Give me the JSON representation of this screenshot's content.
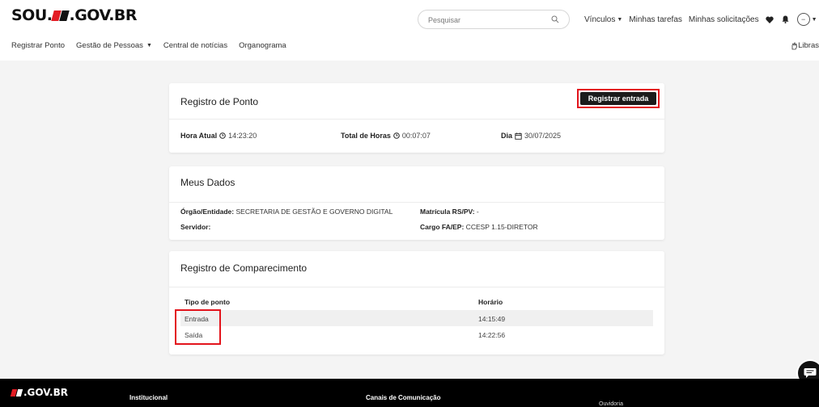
{
  "header": {
    "logo_left": "SOU.",
    "logo_right": ".GOV.BR",
    "search_placeholder": "Pesquisar",
    "nav": {
      "vinculos": "Vínculos",
      "tarefas": "Minhas tarefas",
      "solicitacoes": "Minhas solicitações"
    },
    "libras": "Libras"
  },
  "subnav": {
    "items": [
      "Registrar Ponto",
      "Gestão de Pessoas",
      "Central de notícias",
      "Organograma"
    ]
  },
  "registro_ponto": {
    "title": "Registro de Ponto",
    "button_label": "Registrar entrada",
    "hora_atual_label": "Hora Atual",
    "hora_atual_value": "14:23:20",
    "total_horas_label": "Total de Horas",
    "total_horas_value": "00:07:07",
    "dia_label": "Dia",
    "dia_value": "30/07/2025"
  },
  "meus_dados": {
    "title": "Meus Dados",
    "orgao_label": "Órgão/Entidade:",
    "orgao_value": " SECRETARIA DE GESTÃO E GOVERNO DIGITAL",
    "servidor_label": "Servidor:",
    "servidor_value": "",
    "matricula_label": "Matrícula RS/PV:",
    "matricula_value": " -",
    "cargo_label": "Cargo FA/EP:",
    "cargo_value": " CCESP 1.15-DIRETOR"
  },
  "comparecimento": {
    "title": "Registro de Comparecimento",
    "col_tipo": "Tipo de ponto",
    "col_horario": "Horário",
    "rows": [
      {
        "tipo": "Entrada",
        "horario": "14:15:49"
      },
      {
        "tipo": "Saída",
        "horario": "14:22:56"
      }
    ]
  },
  "footer": {
    "logo": ".GOV.BR",
    "institucional": "Institucional",
    "canais": "Canais de Comunicação",
    "ouvidoria": "Ouvidoria"
  },
  "colors": {
    "brand_red": "#e31c24",
    "dark": "#1c1c1c",
    "highlight": "#e3141c"
  }
}
